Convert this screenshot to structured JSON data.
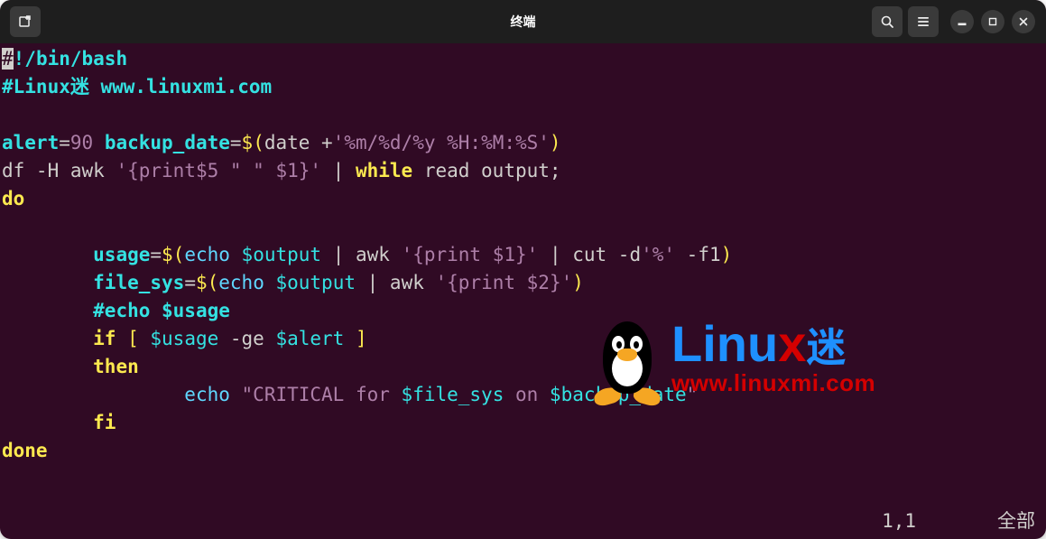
{
  "window": {
    "title": "终端"
  },
  "status": {
    "position": "1,1",
    "scroll": "全部"
  },
  "watermark": {
    "brand": "Linu",
    "xchar": "x",
    "suffix": "迷",
    "url": "www.linuxmi.com"
  },
  "code": {
    "l1_shebang_first": "#",
    "l1_shebang_rest": "!/bin/bash",
    "l2_comment": "#Linux迷 www.linuxmi.com",
    "l4_alert": "alert",
    "l4_eq1": "=",
    "l4_val90": "90",
    "l4_backup": " backup_date",
    "l4_eq2": "=",
    "l4_sub_open": "$(",
    "l4_date": "date +",
    "l4_datestr": "'%m/%d/%y %H:%M:%S'",
    "l4_sub_close": ")",
    "l5_cmd": "df -H awk ",
    "l5_awkstr": "'{print$5 \" \" $1}'",
    "l5_pipe": " | ",
    "l5_while": "while",
    "l5_read": " read output;",
    "l6_do": "do",
    "l8_indent": "        ",
    "l8_usage": "usage",
    "l8_eq": "=",
    "l8_open": "$(",
    "l8_echo": "echo ",
    "l8_var": "$output",
    "l8_pipe1": " | awk ",
    "l8_awks": "'{print $1}'",
    "l8_pipe2": " | cut -d",
    "l8_pct": "'%'",
    "l8_f1": " -f1",
    "l8_close": ")",
    "l9_fs": "file_sys",
    "l9_eq": "=",
    "l9_open": "$(",
    "l9_echo": "echo ",
    "l9_var": "$output",
    "l9_pipe": " | awk ",
    "l9_awks": "'{print $2}'",
    "l9_close": ")",
    "l10_comment": "#echo $usage",
    "l11_if": "if",
    "l11_brkt_o": " [ ",
    "l11_usage": "$usage",
    "l11_ge": " -ge ",
    "l11_alert": "$alert",
    "l11_brkt_c": " ]",
    "l12_then": "then",
    "l13_indent": "                ",
    "l13_echo": "echo ",
    "l13_str_o": "\"",
    "l13_crit": "CRITICAL for ",
    "l13_fs": "$file_sys",
    "l13_on": " on ",
    "l13_bd": "$backup_date",
    "l13_str_c": "\"",
    "l14_fi": "fi",
    "l15_done": "done"
  }
}
